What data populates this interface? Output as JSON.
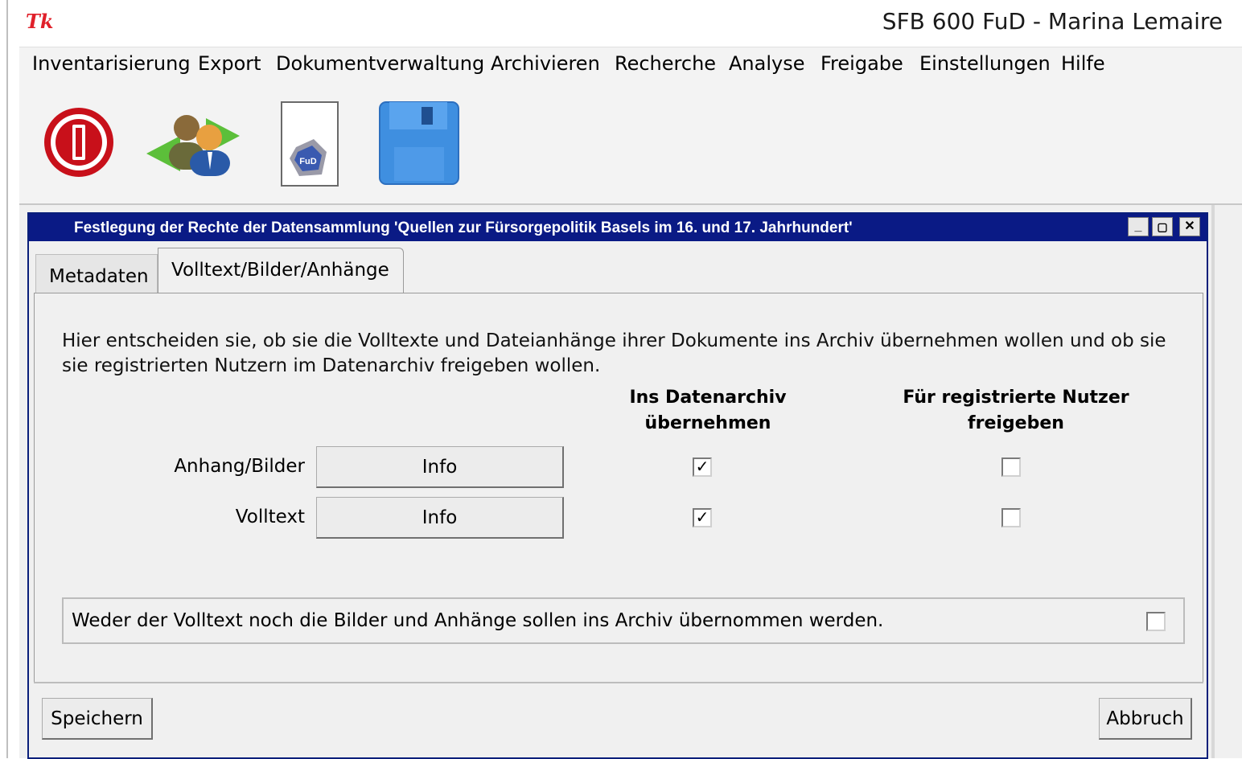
{
  "app": {
    "logo_text": "Tk",
    "title": "SFB 600 FuD - Marina Lemaire"
  },
  "menu": {
    "items": [
      {
        "label": "Inventarisierung"
      },
      {
        "label": "Export"
      },
      {
        "label": "Dokumentverwaltung"
      },
      {
        "label": "Archivieren"
      },
      {
        "label": "Recherche"
      },
      {
        "label": "Analyse"
      },
      {
        "label": "Freigabe"
      },
      {
        "label": "Einstellungen"
      },
      {
        "label": "Hilfe"
      }
    ]
  },
  "toolbar": {
    "tools": [
      {
        "icon": "power-icon"
      },
      {
        "icon": "switch-user-icon"
      },
      {
        "icon": "fud-document-icon",
        "badge": "FuD"
      },
      {
        "icon": "save-floppy-icon"
      }
    ]
  },
  "dialog": {
    "title": "Festlegung der Rechte der Datensammlung 'Quellen zur Fürsorgepolitik Basels im 16. und 17. Jahrhundert'",
    "window_buttons": {
      "minimize": "_",
      "maximize": "▢",
      "close": "✕"
    },
    "tabs": [
      {
        "label": "Metadaten",
        "active": false
      },
      {
        "label": "Volltext/Bilder/Anhänge",
        "active": true
      }
    ],
    "intro": "Hier entscheiden sie, ob sie die Volltexte und Dateianhänge ihrer Dokumente ins Archiv übernehmen wollen und ob sie sie registrierten Nutzern im Datenarchiv freigeben wollen.",
    "columns": {
      "archive_line1": "Ins Datenarchiv",
      "archive_line2": "übernehmen",
      "release_line1": "Für registrierte Nutzer",
      "release_line2": "freigeben"
    },
    "rows": [
      {
        "label": "Anhang/Bilder",
        "info_label": "Info",
        "archive": true,
        "release": false
      },
      {
        "label": "Volltext",
        "info_label": "Info",
        "archive": true,
        "release": false
      }
    ],
    "none_option": {
      "label": "Weder der Volltext noch die Bilder und Anhänge sollen ins Archiv übernommen werden.",
      "checked": false
    },
    "buttons": {
      "save": "Speichern",
      "cancel": "Abbruch"
    }
  }
}
